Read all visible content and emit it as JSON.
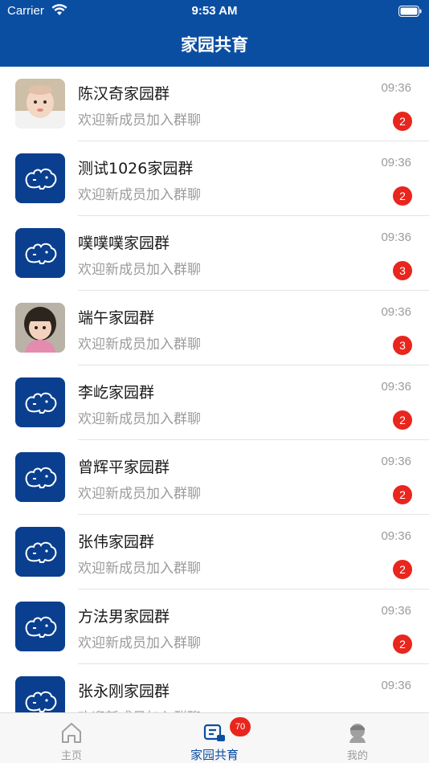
{
  "status_bar": {
    "carrier": "Carrier",
    "time": "9:53 AM"
  },
  "header": {
    "title": "家园共育"
  },
  "chats": [
    {
      "name": "陈汉奇家园群",
      "last_message": "欢迎新成员加入群聊",
      "time": "09:36",
      "unread": "2",
      "avatar": "baby-photo"
    },
    {
      "name": "测试1026家园群",
      "last_message": "欢迎新成员加入群聊",
      "time": "09:36",
      "unread": "2",
      "avatar": "hippo-logo"
    },
    {
      "name": "噗噗噗家园群",
      "last_message": "欢迎新成员加入群聊",
      "time": "09:36",
      "unread": "3",
      "avatar": "hippo-logo"
    },
    {
      "name": "端午家园群",
      "last_message": "欢迎新成员加入群聊",
      "time": "09:36",
      "unread": "3",
      "avatar": "child-photo"
    },
    {
      "name": "李屹家园群",
      "last_message": "欢迎新成员加入群聊",
      "time": "09:36",
      "unread": "2",
      "avatar": "hippo-logo"
    },
    {
      "name": "曾辉平家园群",
      "last_message": "欢迎新成员加入群聊",
      "time": "09:36",
      "unread": "2",
      "avatar": "hippo-logo"
    },
    {
      "name": "张伟家园群",
      "last_message": "欢迎新成员加入群聊",
      "time": "09:36",
      "unread": "2",
      "avatar": "hippo-logo"
    },
    {
      "name": "方法男家园群",
      "last_message": "欢迎新成员加入群聊",
      "time": "09:36",
      "unread": "2",
      "avatar": "hippo-logo"
    },
    {
      "name": "张永刚家园群",
      "last_message": "欢迎新成员加入群聊",
      "time": "09:36",
      "unread": "",
      "avatar": "hippo-logo"
    }
  ],
  "tabbar": {
    "home": {
      "label": "主页",
      "icon": "home-icon"
    },
    "family": {
      "label": "家园共育",
      "icon": "chat-list-icon",
      "badge": "70"
    },
    "mine": {
      "label": "我的",
      "icon": "profile-icon"
    }
  },
  "colors": {
    "brand": "#0a4ea2",
    "badge": "#e8261e",
    "muted": "#9b9b9b"
  }
}
